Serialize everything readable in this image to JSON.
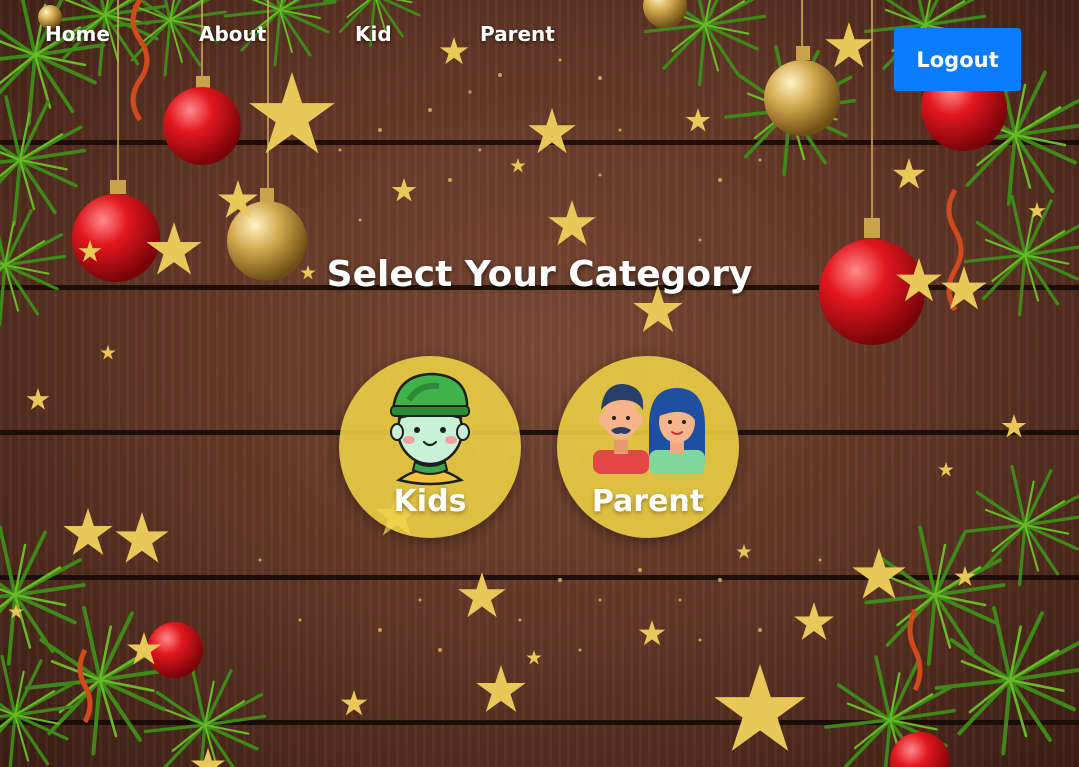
{
  "nav": {
    "links": [
      "Home",
      "About",
      "Kid",
      "Parent"
    ],
    "logout_label": "Logout"
  },
  "main": {
    "title": "Select Your Category",
    "categories": [
      {
        "label": "Kids",
        "icon": "kid-icon"
      },
      {
        "label": "Parent",
        "icon": "parents-icon"
      }
    ]
  },
  "colors": {
    "logout_button": "#0a7cff",
    "category_circle": "#eed246",
    "wood": "#5e3424"
  }
}
